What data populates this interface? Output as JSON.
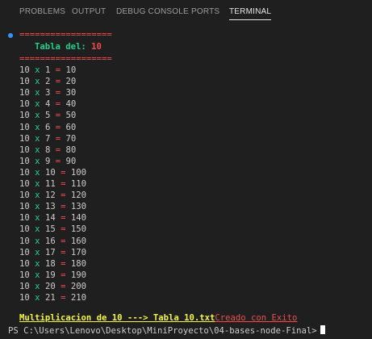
{
  "panel": {
    "tabs": [
      {
        "label": "PROBLEMS"
      },
      {
        "label": "OUTPUT"
      },
      {
        "label": "DEBUG CONSOLE"
      },
      {
        "label": "PORTS"
      },
      {
        "label": "TERMINAL"
      }
    ],
    "active_tab": "TERMINAL"
  },
  "terminal": {
    "separator": "==================",
    "title_label": "Tabla del:",
    "title_number": "10",
    "multiplier_base": "10",
    "rows": [
      {
        "n": "1",
        "r": "10"
      },
      {
        "n": "2",
        "r": "20"
      },
      {
        "n": "3",
        "r": "30"
      },
      {
        "n": "4",
        "r": "40"
      },
      {
        "n": "5",
        "r": "50"
      },
      {
        "n": "6",
        "r": "60"
      },
      {
        "n": "7",
        "r": "70"
      },
      {
        "n": "8",
        "r": "80"
      },
      {
        "n": "9",
        "r": "90"
      },
      {
        "n": "10",
        "r": "100"
      },
      {
        "n": "11",
        "r": "110"
      },
      {
        "n": "12",
        "r": "120"
      },
      {
        "n": "13",
        "r": "130"
      },
      {
        "n": "14",
        "r": "140"
      },
      {
        "n": "15",
        "r": "150"
      },
      {
        "n": "16",
        "r": "160"
      },
      {
        "n": "17",
        "r": "170"
      },
      {
        "n": "18",
        "r": "180"
      },
      {
        "n": "19",
        "r": "190"
      },
      {
        "n": "20",
        "r": "200"
      },
      {
        "n": "21",
        "r": "210"
      }
    ],
    "op_x": "x",
    "op_eq": "=",
    "message_main": "Multiplicacion de 10 ---> Tabla 10.txt",
    "message_status": "Creado con Exito",
    "prompt": "PS C:\\Users\\Lenovo\\Desktop\\MiniProyecto\\04-bases-node-Final>",
    "colors": {
      "background": "#1f1f1f",
      "red": "#f14c4c",
      "green": "#23d18b",
      "yellow": "#f5f543",
      "text": "#cccccc",
      "accent": "#3794ff"
    }
  }
}
